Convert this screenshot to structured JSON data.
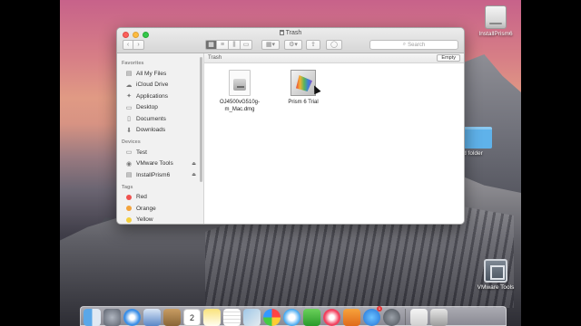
{
  "window": {
    "title": "Trash",
    "search_placeholder": "Search",
    "path_label": "Trash",
    "empty_button": "Empty"
  },
  "sidebar": {
    "favorites_header": "Favorites",
    "favorites": [
      {
        "label": "All My Files",
        "icon": "all-files-icon"
      },
      {
        "label": "iCloud Drive",
        "icon": "cloud-icon"
      },
      {
        "label": "Applications",
        "icon": "applications-icon"
      },
      {
        "label": "Desktop",
        "icon": "desktop-icon"
      },
      {
        "label": "Documents",
        "icon": "documents-icon"
      },
      {
        "label": "Downloads",
        "icon": "downloads-icon"
      }
    ],
    "devices_header": "Devices",
    "devices": [
      {
        "label": "Test",
        "icon": "computer-icon"
      },
      {
        "label": "VMware Tools",
        "icon": "disc-icon",
        "eject": true
      },
      {
        "label": "InstallPrism6",
        "icon": "drive-icon",
        "eject": true
      }
    ],
    "tags_header": "Tags",
    "tags": [
      {
        "label": "Red",
        "color": "#f0524f"
      },
      {
        "label": "Orange",
        "color": "#f3a33b"
      },
      {
        "label": "Yellow",
        "color": "#f4cf3d"
      }
    ]
  },
  "files": [
    {
      "name_line1": "OJ4500vG510g-",
      "name_line2": "m_Mac.dmg",
      "icon": "dmg-file-icon"
    },
    {
      "name_line1": "Prism 6 Trial",
      "name_line2": "",
      "icon": "prism-app-icon"
    }
  ],
  "desktop": {
    "install_drive_label": "InstallPrism6",
    "folder_label": "titled folder",
    "vmware_label": "VMware Tools"
  },
  "dock": {
    "calendar_day": "2",
    "appstore_badge": "1"
  },
  "colors": {
    "close": "#fc605c",
    "minimize": "#fdbc40",
    "maximize": "#34c84a",
    "folder_blue": "#5fb2ea"
  }
}
